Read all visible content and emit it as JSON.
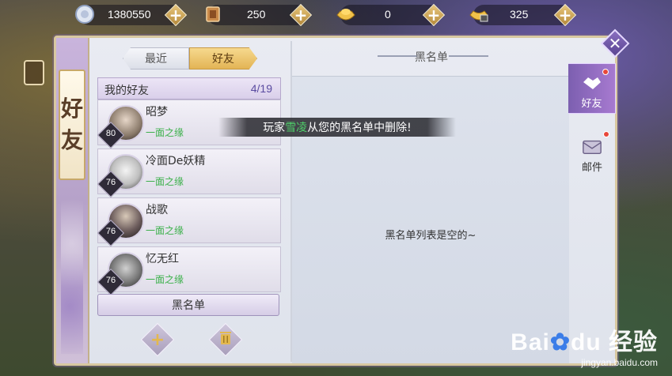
{
  "currency": [
    {
      "icon": "silver-coin-icon",
      "value": "1380550"
    },
    {
      "icon": "token-scroll-icon",
      "value": "250"
    },
    {
      "icon": "gold-ingot-icon",
      "value": "0"
    },
    {
      "icon": "locked-gold-ingot-icon",
      "value": "325"
    }
  ],
  "panel": {
    "title_chars": [
      "好",
      "友"
    ]
  },
  "tabs": {
    "recent": "最近",
    "friends": "好友"
  },
  "friends_header": {
    "label": "我的好友",
    "count": "4/19"
  },
  "friends": [
    {
      "name": "昭梦",
      "level": "80",
      "relation": "一面之缘"
    },
    {
      "name": "冷面De妖精",
      "level": "76",
      "relation": "一面之缘"
    },
    {
      "name": "战歌",
      "level": "76",
      "relation": "一面之缘"
    },
    {
      "name": "忆无红",
      "level": "76",
      "relation": "一面之缘"
    }
  ],
  "blacklist_button": "黑名单",
  "actions": {
    "add": "+",
    "delete_icon": "trash-icon"
  },
  "blacklist_panel": {
    "title": "黑名单",
    "empty_text": "黑名单列表是空的~"
  },
  "toast": {
    "prefix": "玩家",
    "highlight": "雪凌",
    "suffix": "从您的黑名单中删除!"
  },
  "side_tabs": {
    "friends": "好友",
    "mail": "邮件"
  },
  "watermark": {
    "main_a": "Bai",
    "main_b": "du",
    "main_c": "经验",
    "sub": "jingyan.baidu.com"
  },
  "colors": {
    "accent_gold": "#e3b455",
    "relation_green": "#3bb04a",
    "purple_tab": "#a77ad0",
    "notification_red": "#e8473a"
  }
}
